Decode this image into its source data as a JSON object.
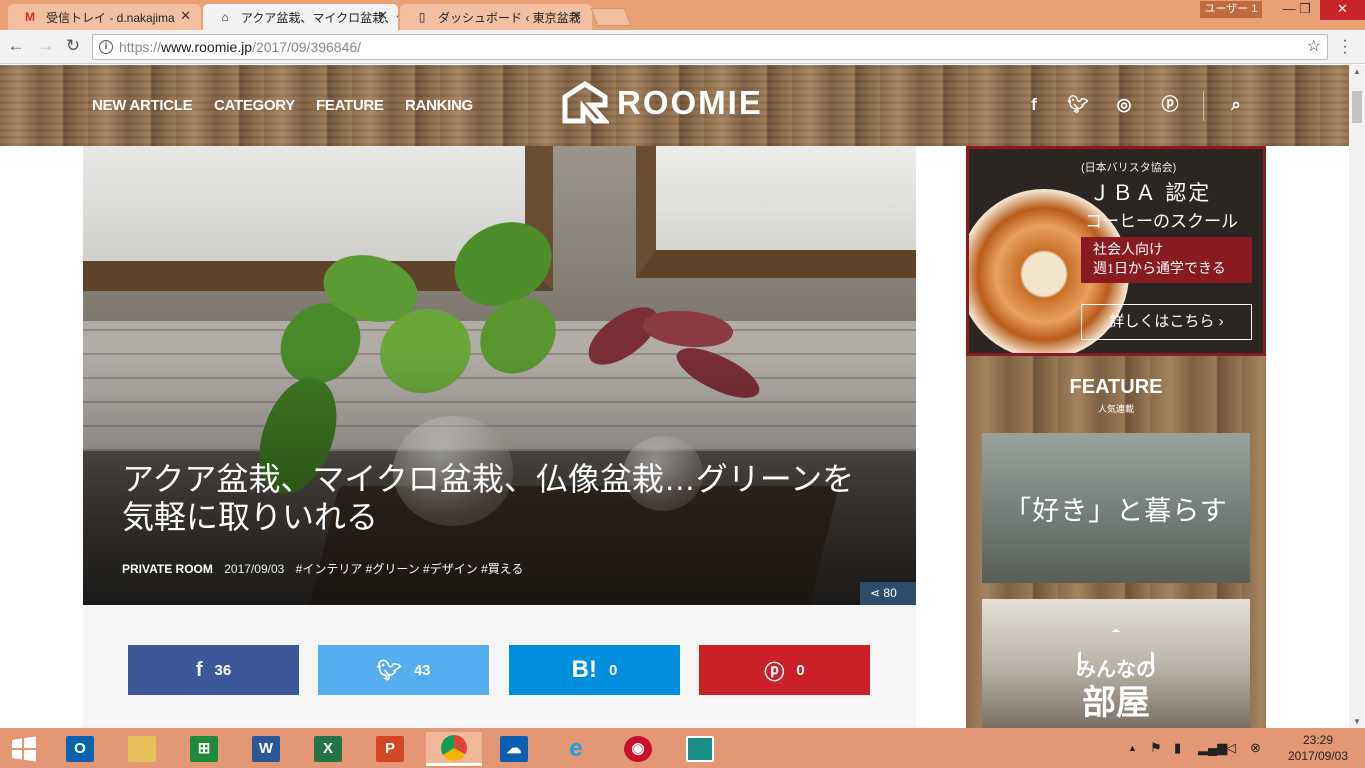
{
  "browser": {
    "tabs": [
      {
        "title": "受信トレイ - d.nakajima",
        "icon": "gmail-icon"
      },
      {
        "title": "アクア盆栽、マイクロ盆栽、仏",
        "icon": "roomie-icon"
      },
      {
        "title": "ダッシュボード ‹ 東京盆栽",
        "icon": "page-icon"
      }
    ],
    "user_label": "ユーザー 1",
    "url_scheme": "https://",
    "url_host": "www.roomie.jp",
    "url_path": "/2017/09/396846/"
  },
  "site": {
    "nav": [
      "NEW ARTICLE",
      "CATEGORY",
      "FEATURE",
      "RANKING"
    ],
    "logo": "ROOMIE",
    "social": [
      "facebook-icon",
      "twitter-icon",
      "instagram-icon",
      "pinterest-icon"
    ]
  },
  "article": {
    "title": "アクア盆栽、マイクロ盆栽、仏像盆栽…グリーンを気軽に取りいれる",
    "category": "PRIVATE ROOM",
    "date": "2017/09/03",
    "tags": "#インテリア #グリーン #デザイン #買える",
    "share_total": "80"
  },
  "share_buttons": [
    {
      "service": "facebook",
      "count": "36",
      "color": "#3b5998"
    },
    {
      "service": "twitter",
      "count": "43",
      "color": "#55acee"
    },
    {
      "service": "hatena",
      "label": "B!",
      "count": "0",
      "color": "#008fde"
    },
    {
      "service": "pinterest",
      "count": "0",
      "color": "#cb2027"
    }
  ],
  "ad": {
    "org": "(日本バリスタ協会)",
    "title": "ＪＢＡ 認定",
    "subtitle": "コーヒーのスクール",
    "box_line1": "社会人向け",
    "box_line2": "週1日から通学できる",
    "cta": "詳しくはこちら ›"
  },
  "feature": {
    "title": "FEATURE",
    "subtitle": "人気連載",
    "card1": "「好き」と暮らす",
    "card2_line1": "みんなの",
    "card2_line2": "部屋"
  },
  "taskbar": {
    "apps": [
      "outlook-icon",
      "file-explorer-icon",
      "store-icon",
      "word-icon",
      "excel-icon",
      "powerpoint-icon",
      "chrome-icon",
      "onedrive-icon",
      "ie-icon",
      "security-icon",
      "photos-icon"
    ],
    "time": "23:29",
    "date": "2017/09/03"
  }
}
